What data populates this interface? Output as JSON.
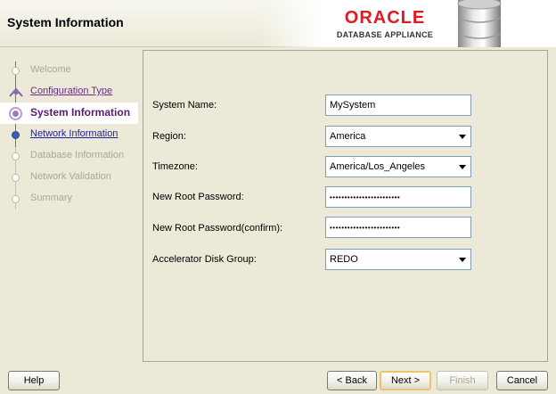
{
  "header": {
    "title": "System Information",
    "brand_name": "ORACLE",
    "brand_product": "DATABASE APPLIANCE"
  },
  "steps": [
    {
      "label": "Welcome",
      "state": "disabled"
    },
    {
      "label": "Configuration Type",
      "state": "visited"
    },
    {
      "label": "System Information",
      "state": "current"
    },
    {
      "label": "Network Information",
      "state": "link"
    },
    {
      "label": "Database Information",
      "state": "disabled"
    },
    {
      "label": "Network Validation",
      "state": "disabled"
    },
    {
      "label": "Summary",
      "state": "disabled"
    }
  ],
  "form": {
    "system_name_label": "System Name:",
    "system_name_value": "MySystem",
    "region_label": "Region:",
    "region_value": "America",
    "timezone_label": "Timezone:",
    "timezone_value": "America/Los_Angeles",
    "root_password_label": "New Root Password:",
    "root_password_value": "••••••••••••••••••••••••",
    "root_password_confirm_label": "New Root Password(confirm):",
    "root_password_confirm_value": "••••••••••••••••••••••••",
    "disk_group_label": "Accelerator Disk Group:",
    "disk_group_value": "REDO"
  },
  "buttons": {
    "help_label": "Help",
    "back_label": "< Back",
    "next_label": "Next >",
    "finish_label": "Finish",
    "cancel_label": "Cancel"
  },
  "colors": {
    "brand_red": "#e01a22",
    "current_step": "#5a1a7a",
    "link": "#1f1fa8",
    "default_button_border": "#e8c46a"
  }
}
